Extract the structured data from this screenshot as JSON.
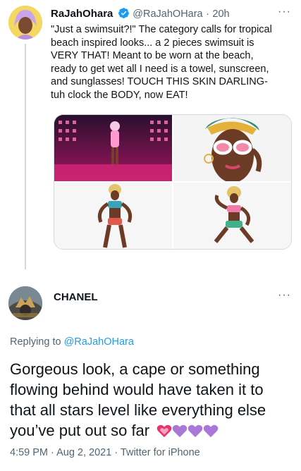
{
  "tweet": {
    "display_name": "RaJahOhara",
    "handle": "@RaJahOHara",
    "separator": "·",
    "time": "20h",
    "more_label": "···",
    "text_lines": [
      "\"Just a swimsuit?!\" The category calls for tropical",
      "beach inspired looks... a 2 pieces swimsuit is",
      "VERY THAT!  Meant to be worn at the beach,",
      "ready to get wet all I need is a towel, sunscreen,",
      "and sunglasses! TOUCH THIS SKIN DARLING-",
      "tuh  clock the BODY, now EAT!"
    ],
    "verified_icon": "verified-badge-icon",
    "photos": [
      "runway-photo",
      "sunglasses-closeup-photo",
      "full-body-pose-photo",
      "seated-pose-photo"
    ]
  },
  "reply": {
    "display_name": "CHANEL",
    "more_label": "···",
    "replying_to_prefix": "Replying to ",
    "replying_to_handle": "@RaJahOHara",
    "text_lines": [
      "Gorgeous look, a cape or something",
      "flowing behind would have taken it to",
      "that all stars level like everything else",
      "you’ve put out so far"
    ],
    "emojis": [
      "sparkling-heart",
      "purple-heart",
      "purple-heart",
      "purple-heart"
    ],
    "timestamp": "4:59 PM · Aug 2, 2021 · ",
    "client": "Twitter for iPhone"
  },
  "colors": {
    "accent": "#1d9bf0",
    "muted": "#536471",
    "text": "#0f1419",
    "purple_heart": "#a977d8",
    "pink_heart": "#e8356d"
  }
}
